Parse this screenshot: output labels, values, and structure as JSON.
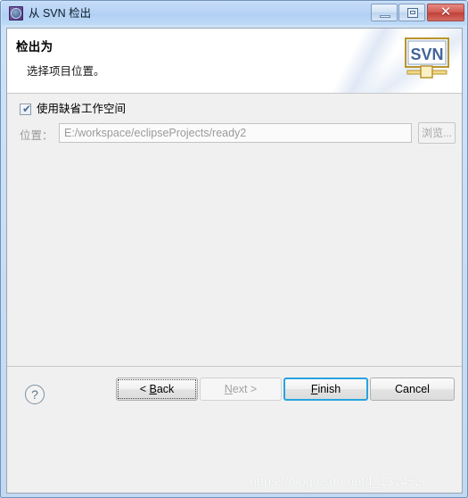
{
  "window": {
    "title": "从 SVN 检出",
    "icon": "svn-app-icon",
    "controls": {
      "minimize": "minimize-icon",
      "maximize": "maximize-icon",
      "close": "✕"
    }
  },
  "header": {
    "title": "检出为",
    "subtitle": "选择项目位置。",
    "logo_text": "SVN"
  },
  "form": {
    "use_default_workspace": {
      "label": "使用缺省工作空间",
      "checked": true,
      "check_glyph": "✔"
    },
    "location": {
      "label": "位置：",
      "value": "E:/workspace/eclipseProjects/ready2",
      "placeholder": "",
      "disabled": true
    },
    "browse_button": {
      "label": "浏览...",
      "disabled": true
    }
  },
  "buttonbar": {
    "help_glyph": "?",
    "back": "< Back",
    "back_prefix": "< ",
    "back_mnemonic": "B",
    "back_suffix": "ack",
    "next_prefix": "",
    "next_mnemonic": "N",
    "next_suffix": "ext >",
    "finish_mnemonic": "F",
    "finish_suffix": "inish",
    "cancel": "Cancel"
  },
  "watermark": {
    "text": "https://blog.csdn.net/f_1314520"
  },
  "colors": {
    "titlebar": "#b7d3f4",
    "close_button": "#c04039",
    "default_button_border": "#27a4e0",
    "body": "#f0f0f0",
    "disabled_text": "#9a9a9a"
  }
}
